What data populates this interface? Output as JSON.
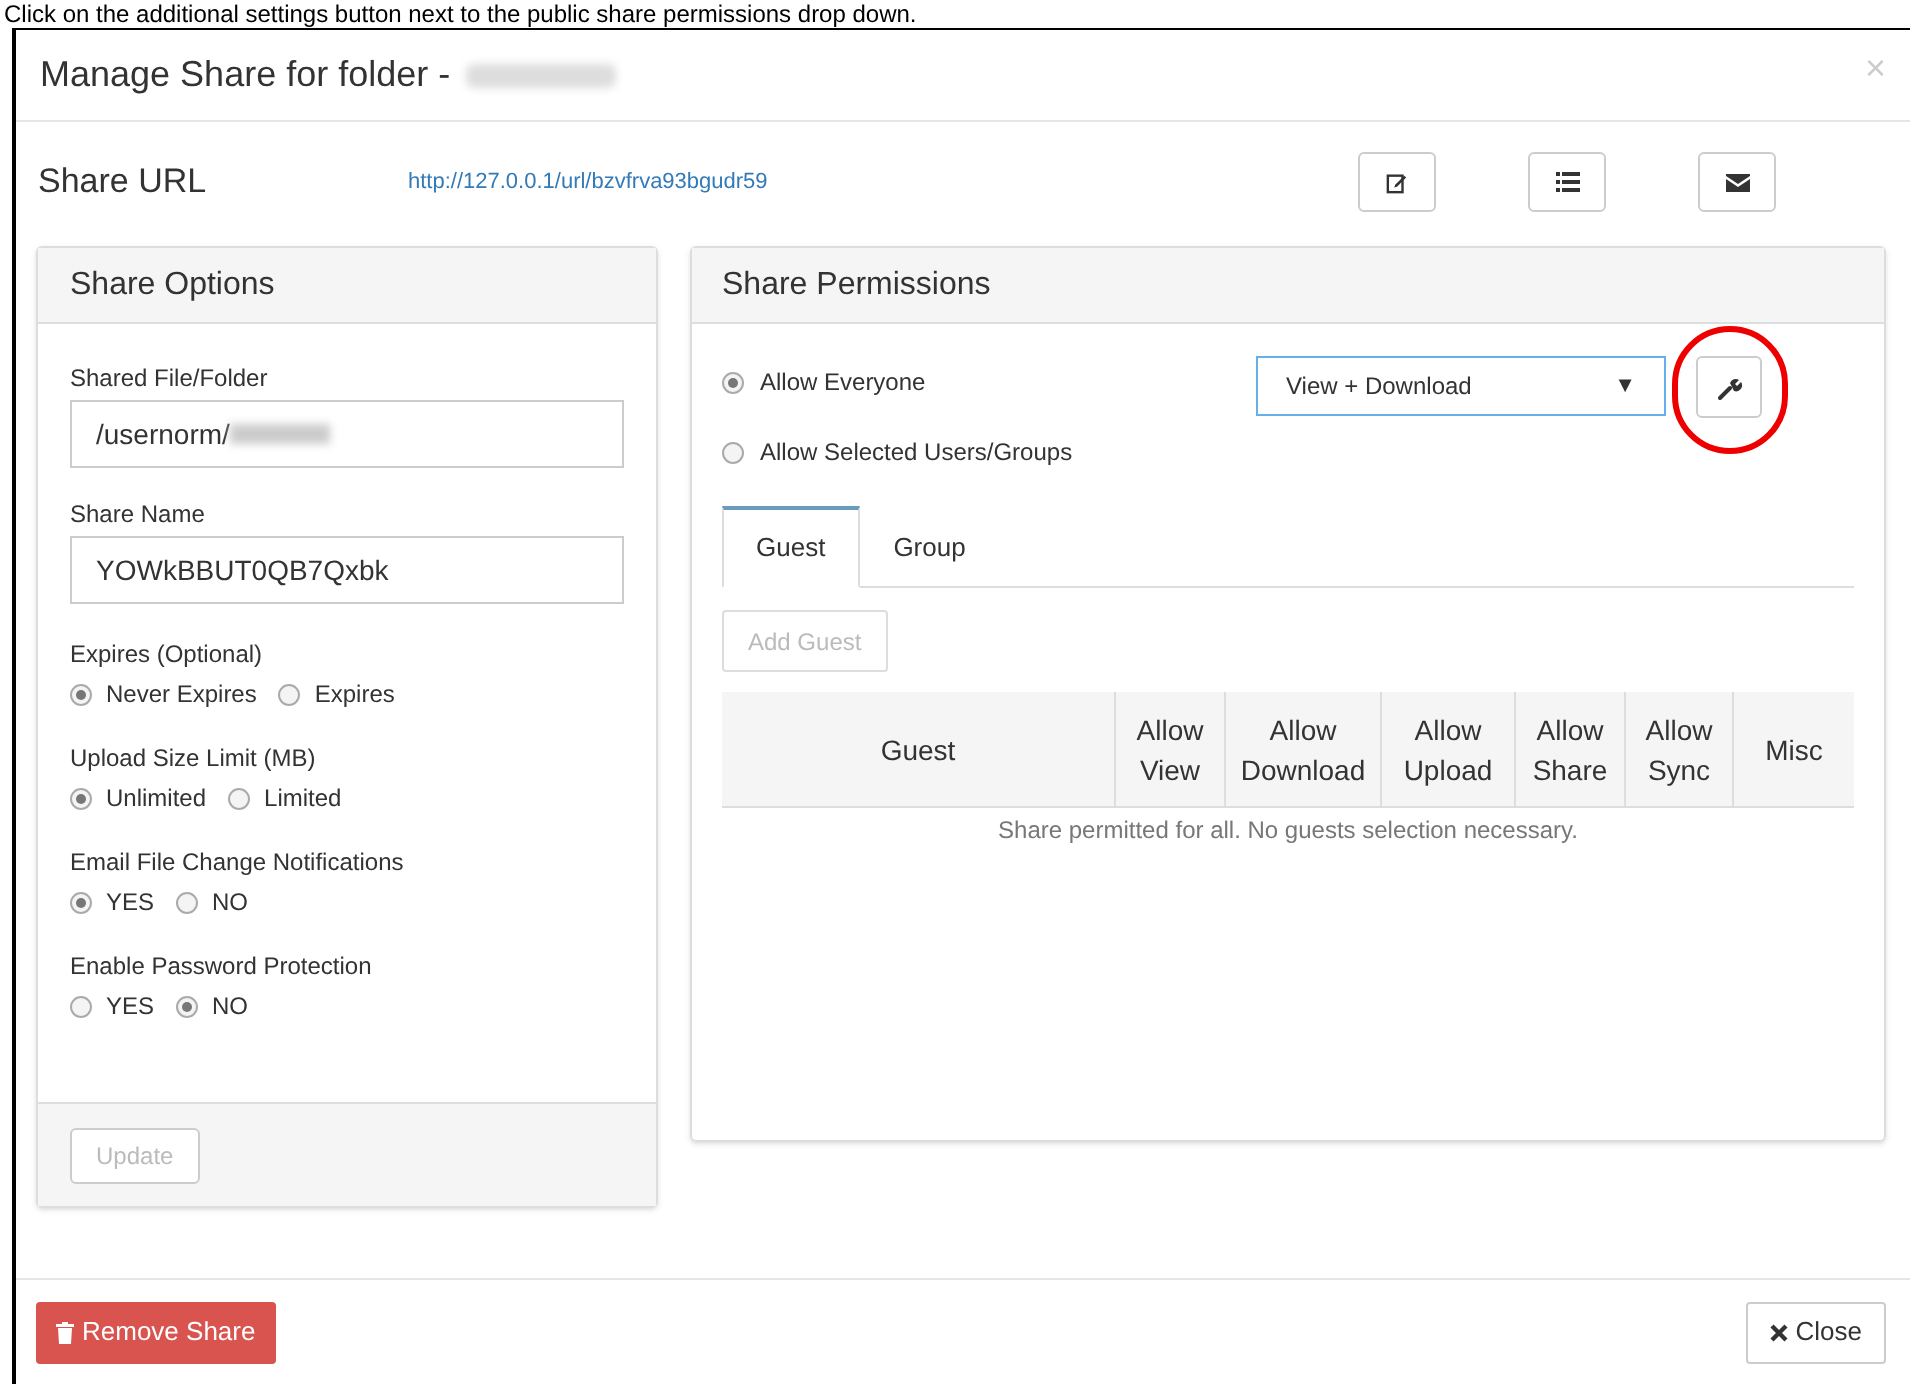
{
  "caption": "Click on the additional settings button next to the public share permissions drop down.",
  "dialog": {
    "title": "Manage Share for folder -",
    "close": "×"
  },
  "share_url": {
    "label": "Share URL",
    "url": "http://127.0.0.1/url/bzvfrva93bgudr59"
  },
  "share_options": {
    "title": "Share Options",
    "fields": [
      {
        "label": "Shared File/Folder",
        "value": "/usernorm/",
        "redacted": true
      },
      {
        "label": "Share Name",
        "value": "YOWkBBUT0QB7Qxbk",
        "redacted": false
      }
    ],
    "radio_groups": [
      {
        "label": "Expires (Optional)",
        "options": [
          {
            "label": "Never Expires",
            "selected": true
          },
          {
            "label": "Expires",
            "selected": false
          }
        ]
      },
      {
        "label": "Upload Size Limit (MB)",
        "options": [
          {
            "label": "Unlimited",
            "selected": true
          },
          {
            "label": "Limited",
            "selected": false
          }
        ]
      },
      {
        "label": "Email File Change Notifications",
        "options": [
          {
            "label": "YES",
            "selected": true
          },
          {
            "label": "NO",
            "selected": false
          }
        ]
      },
      {
        "label": "Enable Password Protection",
        "options": [
          {
            "label": "YES",
            "selected": false
          },
          {
            "label": "NO",
            "selected": true
          }
        ]
      }
    ],
    "update_button": {
      "label": "Update",
      "disabled": true
    }
  },
  "share_permissions": {
    "title": "Share Permissions",
    "access": [
      {
        "label": "Allow Everyone",
        "selected": true
      },
      {
        "label": "Allow Selected Users/Groups",
        "selected": false
      }
    ],
    "permission_select": {
      "value": "View + Download",
      "arrow": "▼"
    },
    "settings_highlighted": true,
    "tabs": [
      {
        "label": "Guest",
        "selected": true
      },
      {
        "label": "Group",
        "selected": false
      }
    ],
    "add_button": {
      "label": "Add Guest",
      "disabled": true
    },
    "table": {
      "columns": [
        "Guest",
        "Allow View",
        "Allow Download",
        "Allow Upload",
        "Allow Share",
        "Allow Sync",
        "Misc"
      ],
      "empty_message": "Share permitted for all. No guests selection necessary."
    }
  },
  "footer": {
    "remove": "Remove Share",
    "close": "Close"
  }
}
